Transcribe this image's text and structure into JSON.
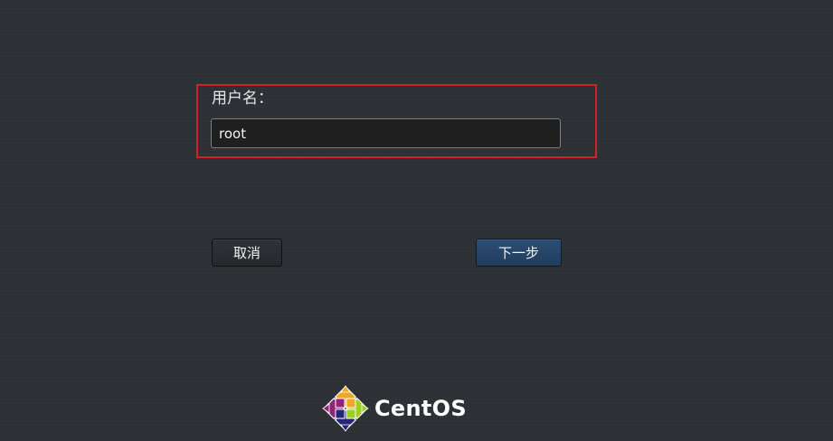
{
  "login": {
    "username_label": "用户名：",
    "username_value": "root"
  },
  "buttons": {
    "cancel_label": "取消",
    "next_label": "下一步"
  },
  "brand": {
    "name": "CentOS",
    "logo_icon": "centos-logo-icon"
  },
  "colors": {
    "background": "#2d3034",
    "highlight_border": "#d4202a",
    "next_button": "#2b4d73",
    "centos_purple": "#932279",
    "centos_green": "#9ccd2a",
    "centos_blue": "#262577",
    "centos_yellow": "#efa724"
  }
}
